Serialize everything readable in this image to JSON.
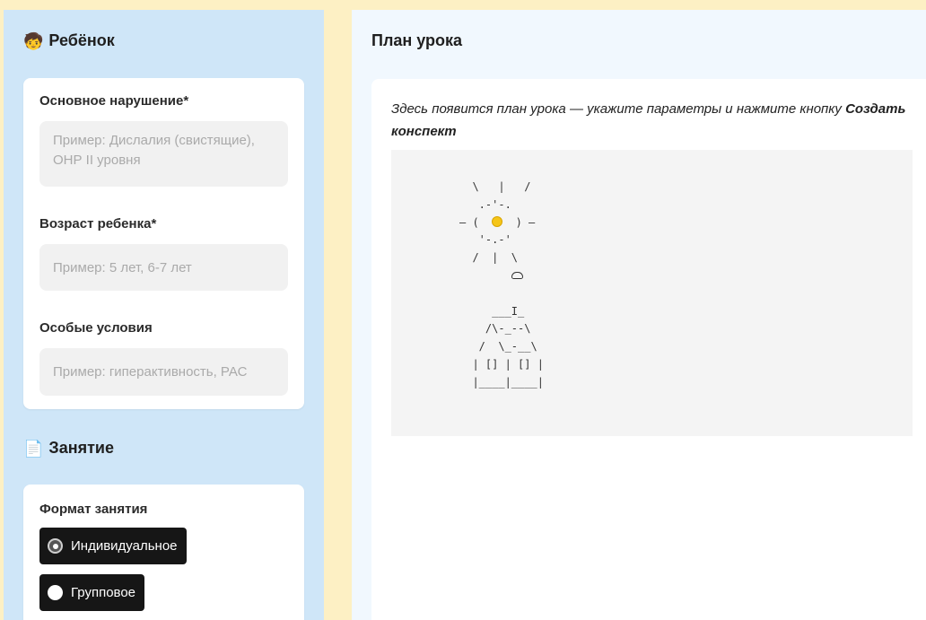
{
  "sidebar": {
    "child_section": {
      "emoji": "🧒",
      "title": "Ребёнок"
    },
    "fields": [
      {
        "label": "Основное нарушение*",
        "placeholder": "Пример: Дислалия (свистящие), ОНР II уровня"
      },
      {
        "label": "Возраст ребенка*",
        "placeholder": "Пример: 5 лет, 6-7 лет"
      },
      {
        "label": "Особые условия",
        "placeholder": "Пример: гиперактивность, РАС"
      }
    ],
    "lesson_section": {
      "emoji": "📄",
      "title": "Занятие"
    },
    "format": {
      "label": "Формат занятия",
      "options": [
        {
          "label": "Индивидуальное",
          "selected": true
        },
        {
          "label": "Групповое",
          "selected": false
        }
      ]
    }
  },
  "main": {
    "title": "План урока",
    "hint_text": "Здесь появится план урока — укажите параметры и нажмите кнопку ",
    "hint_button_name": "Создать конспект",
    "ascii_art": {
      "line1": "  \\   |   /",
      "line2a": "   .-'",
      "line2b": "-.",
      "line3a": "— (  ",
      "line3b": "  ) —",
      "line4": "   '-.-'",
      "line5": "  /  |  \\",
      "line7": "     ___I_",
      "line8": "    /\\-_--\\",
      "line9": "   /  \\_-__\\",
      "line10": "  | [] | [] |",
      "line11": "  |____|____|"
    }
  }
}
